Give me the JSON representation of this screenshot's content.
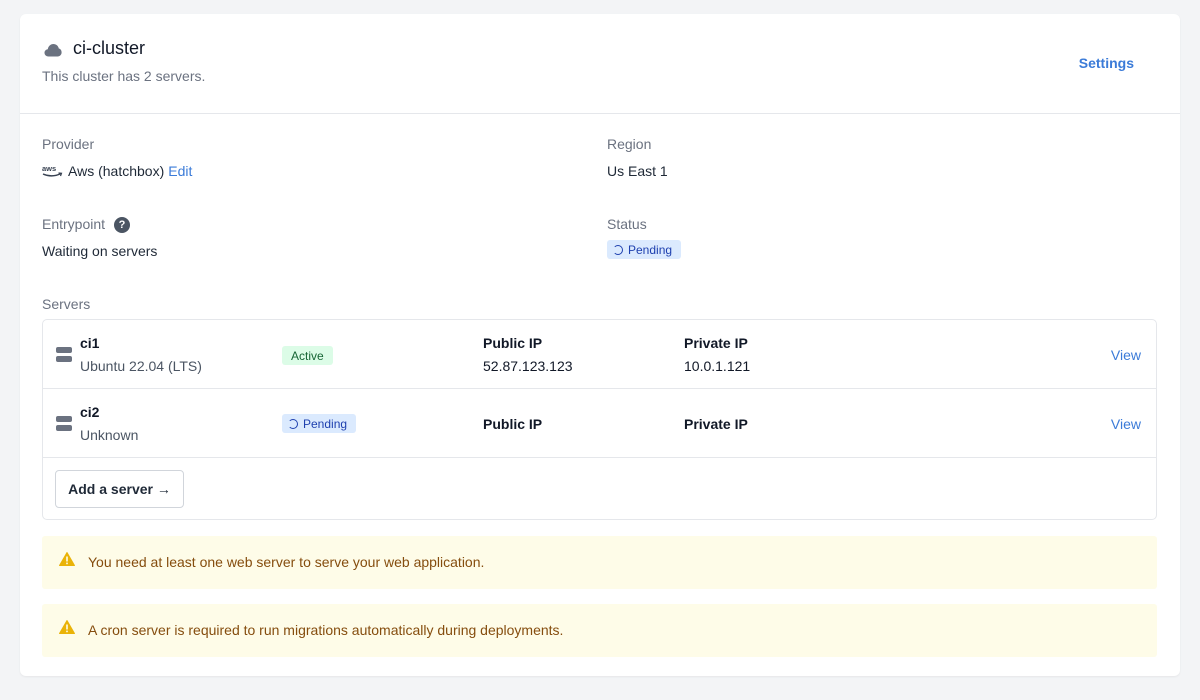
{
  "cluster": {
    "name": "ci-cluster",
    "subtitle": "This cluster has 2 servers.",
    "settings_label": "Settings"
  },
  "details": {
    "provider_label": "Provider",
    "provider_value": "Aws (hatchbox)",
    "edit_label": "Edit",
    "region_label": "Region",
    "region_value": "Us East 1",
    "entrypoint_label": "Entrypoint",
    "entrypoint_help": "?",
    "entrypoint_value": "Waiting on servers",
    "status_label": "Status",
    "status_value": "Pending"
  },
  "servers_label": "Servers",
  "servers": [
    {
      "name": "ci1",
      "os": "Ubuntu 22.04 (LTS)",
      "status": "Active",
      "public_ip_label": "Public IP",
      "public_ip": "52.87.123.123",
      "private_ip_label": "Private IP",
      "private_ip": "10.0.1.121",
      "view_label": "View"
    },
    {
      "name": "ci2",
      "os": "Unknown",
      "status": "Pending",
      "public_ip_label": "Public IP",
      "public_ip": "",
      "private_ip_label": "Private IP",
      "private_ip": "",
      "view_label": "View"
    }
  ],
  "add_server_label": "Add a server →",
  "alerts": [
    {
      "text": "You need at least one web server to serve your web application."
    },
    {
      "text": "A cron server is required to run migrations automatically during deployments."
    }
  ],
  "icons": {
    "cluster": "cloud-icon",
    "provider": "aws-logo",
    "help": "question-circle-icon",
    "server": "server-icon",
    "warning": "warning-triangle-icon",
    "spinner": "spinner-icon"
  },
  "colors": {
    "link": "#3b7bd8",
    "pending_bg": "#dbeafe",
    "pending_text": "#1e40af",
    "active_bg": "#dcfce7",
    "active_text": "#166534",
    "alert_bg": "#fefce8",
    "alert_text": "#854d0e",
    "warning_icon": "#eab308"
  }
}
